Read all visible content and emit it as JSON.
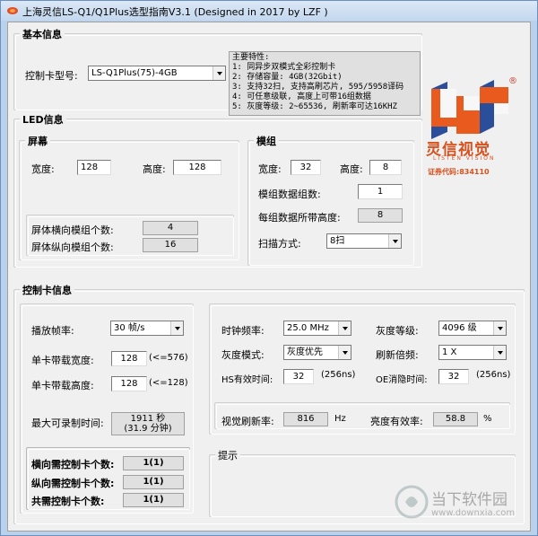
{
  "window": {
    "title": "上海灵信LS-Q1/Q1Plus选型指南V3.1  (Designed in 2017 by LZF )"
  },
  "basic": {
    "group_title": "基本信息",
    "model_label": "控制卡型号:",
    "model_value": "LS-Q1Plus(75)-4GB",
    "features_title": "主要特性:",
    "features": [
      "1: 同异步双模式全彩控制卡",
      "2: 存储容量: 4GB(32Gbit)",
      "3: 支持32扫, 支持高刷芯片, 595/5958译码",
      "4: 可任意级联, 高度上可带16组数据",
      "5: 灰度等级: 2~65536, 刷新率可达16KHZ"
    ]
  },
  "led": {
    "group_title": "LED信息",
    "screen": {
      "title": "屏幕",
      "width_label": "宽度:",
      "width_value": "128",
      "height_label": "高度:",
      "height_value": "128",
      "h_modules_label": "屏体横向模组个数:",
      "h_modules_value": "4",
      "v_modules_label": "屏体纵向模组个数:",
      "v_modules_value": "16"
    },
    "module": {
      "title": "模组",
      "width_label": "宽度:",
      "width_value": "32",
      "height_label": "高度:",
      "height_value": "8",
      "data_groups_label": "模组数据组数:",
      "data_groups_value": "1",
      "per_group_height_label": "每组数据所带高度:",
      "per_group_height_value": "8",
      "scan_label": "扫描方式:",
      "scan_value": "8扫"
    }
  },
  "card": {
    "group_title": "控制卡信息",
    "fps_label": "播放帧率:",
    "fps_value": "30 帧/s",
    "load_width_label": "单卡带载宽度:",
    "load_width_value": "128",
    "load_width_hint": "(<=576)",
    "load_height_label": "单卡带载高度:",
    "load_height_value": "128",
    "load_height_hint": "(<=128)",
    "max_record_label": "最大可录制时间:",
    "max_record_line1": "1911 秒",
    "max_record_line2": "(31.9 分钟)",
    "h_cards_label": "横向需控制卡个数:",
    "h_cards_value": "1(1)",
    "v_cards_label": "纵向需控制卡个数:",
    "v_cards_value": "1(1)",
    "total_cards_label": "共需控制卡个数:",
    "total_cards_value": "1(1)",
    "clock_label": "时钟频率:",
    "clock_value": "25.0 MHz",
    "gray_level_label": "灰度等级:",
    "gray_level_value": "4096 级",
    "gray_mode_label": "灰度模式:",
    "gray_mode_value": "灰度优先",
    "refresh_mult_label": "刷新倍频:",
    "refresh_mult_value": "1 X",
    "hs_label": "HS有效时间:",
    "hs_value": "32",
    "hs_unit": "(256ns)",
    "oe_label": "OE消隐时间:",
    "oe_value": "32",
    "oe_unit": "(256ns)",
    "visual_refresh_label": "视觉刷新率:",
    "visual_refresh_value": "816",
    "visual_refresh_unit": "Hz",
    "brightness_label": "亮度有效率:",
    "brightness_value": "58.8",
    "brightness_unit": "%",
    "tips_title": "提示"
  },
  "logo": {
    "name": "灵信视觉",
    "sub": "LISTEN VISION",
    "code": "证券代码:834110",
    "reg": "®",
    "brand_color": "#e85a1e",
    "brand_blue": "#2a4e9a"
  },
  "watermark": {
    "name": "当下软件园",
    "url": "www.downxia.com"
  }
}
